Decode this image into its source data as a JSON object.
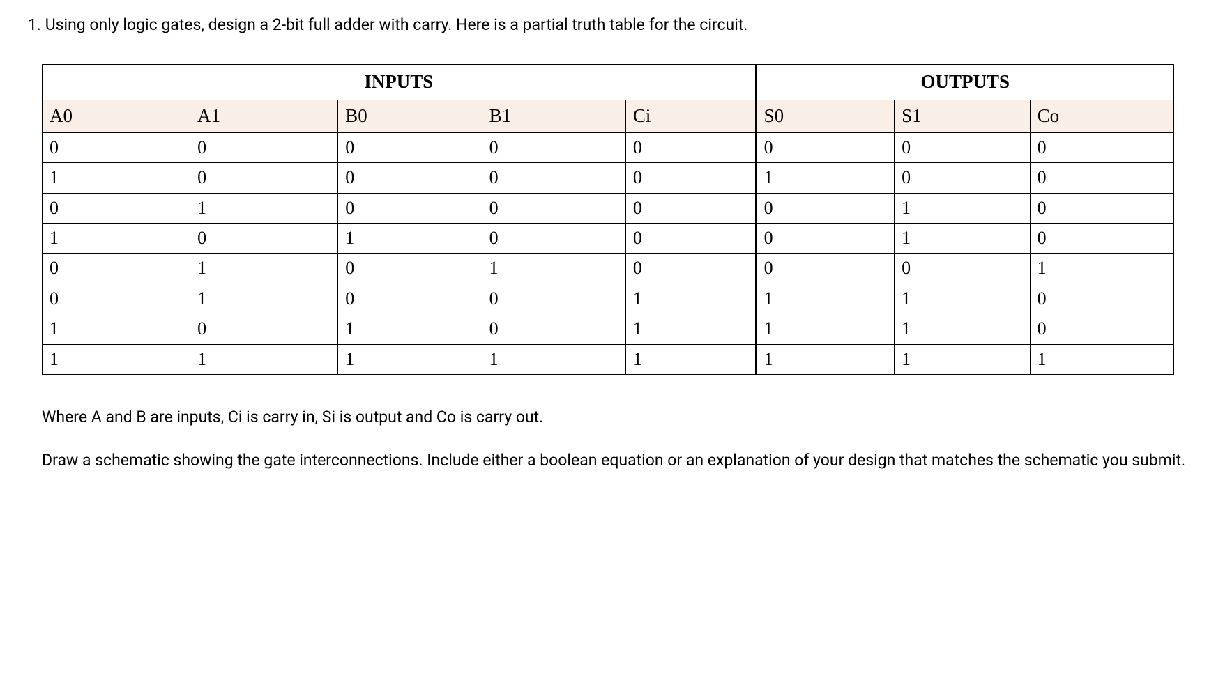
{
  "question": {
    "prompt": "1. Using only logic gates, design a 2-bit full adder with carry. Here is a partial truth table for the circuit.",
    "caption": "Where A and B are inputs, Ci is carry in, Si is output and Co is carry out.",
    "instruction": "Draw a schematic showing the gate interconnections. Include either a boolean equation or an explanation of your design that matches the schematic you submit."
  },
  "table": {
    "group_headers": {
      "inputs": "INPUTS",
      "outputs": "OUTPUTS"
    },
    "columns": [
      "A0",
      "A1",
      "B0",
      "B1",
      "Ci",
      "S0",
      "S1",
      "Co"
    ],
    "rows": [
      [
        "0",
        "0",
        "0",
        "0",
        "0",
        "0",
        "0",
        "0"
      ],
      [
        "1",
        "0",
        "0",
        "0",
        "0",
        "1",
        "0",
        "0"
      ],
      [
        "0",
        "1",
        "0",
        "0",
        "0",
        "0",
        "1",
        "0"
      ],
      [
        "1",
        "0",
        "1",
        "0",
        "0",
        "0",
        "1",
        "0"
      ],
      [
        "0",
        "1",
        "0",
        "1",
        "0",
        "0",
        "0",
        "1"
      ],
      [
        "0",
        "1",
        "0",
        "0",
        "1",
        "1",
        "1",
        "0"
      ],
      [
        "1",
        "0",
        "1",
        "0",
        "1",
        "1",
        "1",
        "0"
      ],
      [
        "1",
        "1",
        "1",
        "1",
        "1",
        "1",
        "1",
        "1"
      ]
    ]
  }
}
